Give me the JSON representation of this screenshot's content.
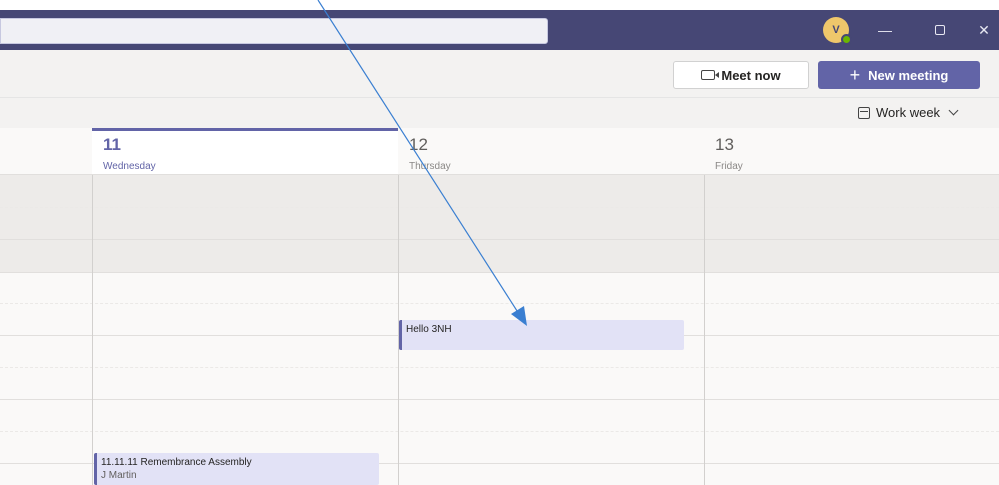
{
  "titlebar": {
    "avatar_initial": "V",
    "presence_color": "#6bb700",
    "brand_color": "#464775",
    "min_icon": "minimize-icon",
    "max_icon": "maximize-icon",
    "close_icon": "close-icon",
    "close_glyph": "✕",
    "min_glyph": "—"
  },
  "toolbar": {
    "meet_now_label": "Meet now",
    "new_meeting_label": "New meeting",
    "accent_color": "#6264a7"
  },
  "view": {
    "label": "Work week"
  },
  "days": [
    {
      "num": "11",
      "name": "Wednesday",
      "today": true
    },
    {
      "num": "12",
      "name": "Thursday",
      "today": false
    },
    {
      "num": "13",
      "name": "Friday",
      "today": false
    }
  ],
  "events": [
    {
      "title": "Hello 3NH",
      "organizer": ""
    },
    {
      "title": "11.11.11 Remembrance Assembly",
      "organizer": "J Martin"
    }
  ]
}
